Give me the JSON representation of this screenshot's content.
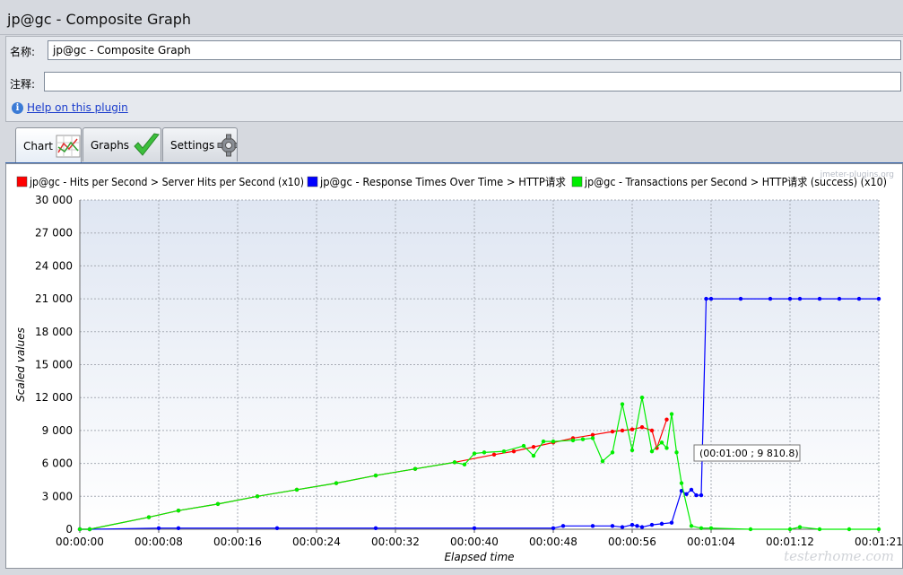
{
  "window": {
    "title": "jp@gc - Composite Graph"
  },
  "form": {
    "name_label": "名称:",
    "name_value": "jp@gc - Composite Graph",
    "comment_label": "注释:",
    "comment_value": "",
    "help_label": "Help on this plugin"
  },
  "tabs": [
    {
      "label": "Chart",
      "icon": "chart-icon",
      "active": true
    },
    {
      "label": "Graphs",
      "icon": "checkmark-icon",
      "active": false
    },
    {
      "label": "Settings",
      "icon": "gear-icon",
      "active": false
    }
  ],
  "watermark": "jmeter-plugins.org",
  "site_watermark": "testerhome.com",
  "chart_data": {
    "type": "line",
    "xlabel": "Elapsed time",
    "ylabel": "Scaled values",
    "ylim": [
      0,
      30000
    ],
    "xlim": [
      0,
      81
    ],
    "x_unit": "seconds",
    "x_ticks": [
      "00:00:00",
      "00:00:08",
      "00:00:16",
      "00:00:24",
      "00:00:32",
      "00:00:40",
      "00:00:48",
      "00:00:56",
      "00:01:04",
      "00:01:12",
      "00:01:21"
    ],
    "x_tick_values": [
      0,
      8,
      16,
      24,
      32,
      40,
      48,
      56,
      64,
      72,
      81
    ],
    "y_ticks": [
      "0",
      "3 000",
      "6 000",
      "9 000",
      "12 000",
      "15 000",
      "18 000",
      "21 000",
      "24 000",
      "27 000",
      "30 000"
    ],
    "y_tick_values": [
      0,
      3000,
      6000,
      9000,
      12000,
      15000,
      18000,
      21000,
      24000,
      27000,
      30000
    ],
    "grid": true,
    "legend_position": "top",
    "tooltip": "(00:01:00 ; 9 810.8)",
    "series": [
      {
        "name": "jp@gc - Hits per Second > Server Hits per Second (x10)",
        "color": "#ff0000",
        "x": [
          0,
          1,
          7,
          10,
          14,
          18,
          22,
          26,
          30,
          34,
          38,
          42,
          44,
          46,
          48,
          50,
          52,
          54,
          55,
          56,
          57,
          58,
          58.5,
          59.5
        ],
        "y": [
          0,
          0,
          1100,
          1700,
          2300,
          3000,
          3600,
          4200,
          4900,
          5500,
          6100,
          6800,
          7100,
          7500,
          7900,
          8300,
          8600,
          8900,
          9000,
          9100,
          9300,
          9000,
          7400,
          10000
        ]
      },
      {
        "name": "jp@gc - Response Times Over Time > HTTP请求",
        "color": "#0000ff",
        "x": [
          0,
          1,
          8,
          10,
          20,
          30,
          40,
          48,
          49,
          52,
          54,
          55,
          56,
          56.5,
          57,
          58,
          59,
          60,
          61,
          61.5,
          62,
          62.5,
          63,
          63.5,
          64,
          67,
          70,
          72,
          73,
          75,
          77,
          79,
          81
        ],
        "y": [
          0,
          0,
          100,
          100,
          100,
          100,
          100,
          100,
          300,
          300,
          300,
          200,
          400,
          300,
          200,
          400,
          500,
          600,
          3500,
          3200,
          3600,
          3100,
          3100,
          21000,
          21000,
          21000,
          21000,
          21000,
          21000,
          21000,
          21000,
          21000,
          21000
        ],
        "series_x_shift": true
      },
      {
        "name": "jp@gc - Transactions per Second > HTTP请求 (success) (x10)",
        "color": "#00ee00",
        "x": [
          0,
          1,
          7,
          10,
          14,
          18,
          22,
          26,
          30,
          34,
          38,
          39,
          40,
          41,
          43,
          45,
          46,
          47,
          48,
          50,
          51,
          52,
          53,
          54,
          55,
          56,
          57,
          58,
          59,
          59.5,
          60,
          60.5,
          61,
          62,
          63,
          64,
          68,
          72,
          73,
          75,
          78,
          81
        ],
        "y": [
          0,
          0,
          1100,
          1700,
          2300,
          3000,
          3600,
          4200,
          4900,
          5500,
          6100,
          5900,
          6900,
          7000,
          7100,
          7600,
          6700,
          8000,
          8000,
          8100,
          8200,
          8300,
          6200,
          7000,
          11400,
          7200,
          12000,
          7100,
          7900,
          7400,
          10500,
          7000,
          4200,
          300,
          100,
          100,
          0,
          0,
          200,
          0,
          0,
          0
        ]
      }
    ]
  }
}
